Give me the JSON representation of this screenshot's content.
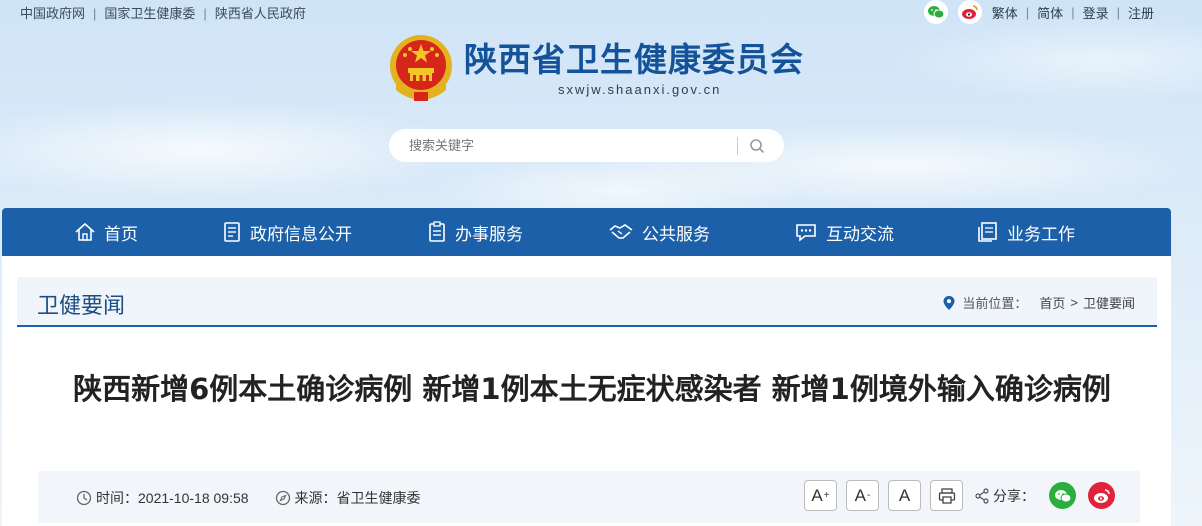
{
  "topbar": {
    "links": [
      "中国政府网",
      "国家卫生健康委",
      "陕西省人民政府"
    ]
  },
  "topright": {
    "links": [
      "繁体",
      "简体",
      "登录",
      "注册"
    ],
    "icons": [
      "wechat-icon",
      "weibo-icon"
    ]
  },
  "header": {
    "site_name": "陕西省卫生健康委员会",
    "site_url": "sxwjw.shaanxi.gov.cn"
  },
  "search": {
    "placeholder": "搜索关键字"
  },
  "nav": {
    "items": [
      {
        "label": "首页",
        "icon": "home-icon"
      },
      {
        "label": "政府信息公开",
        "icon": "document-icon"
      },
      {
        "label": "办事服务",
        "icon": "clipboard-icon"
      },
      {
        "label": "公共服务",
        "icon": "handshake-icon"
      },
      {
        "label": "互动交流",
        "icon": "chat-icon"
      },
      {
        "label": "业务工作",
        "icon": "file-icon"
      }
    ]
  },
  "section": {
    "title": "卫健要闻",
    "breadcrumb_label": "当前位置：",
    "breadcrumb": [
      "首页",
      "卫健要闻"
    ]
  },
  "article": {
    "title": "陕西新增6例本土确诊病例 新增1例本土无症状感染者 新增1例境外输入确诊病例",
    "time_label": "时间：",
    "time": "2021-10-18 09:58",
    "source_label": "来源：",
    "source": "省卫生健康委",
    "font_large": "A",
    "font_small": "A",
    "font_normal": "A",
    "share_label": "分享："
  },
  "colors": {
    "nav": "#1b60a8",
    "title": "#14539a",
    "wechat": "#2aae3c",
    "weibo": "#e0223a"
  }
}
